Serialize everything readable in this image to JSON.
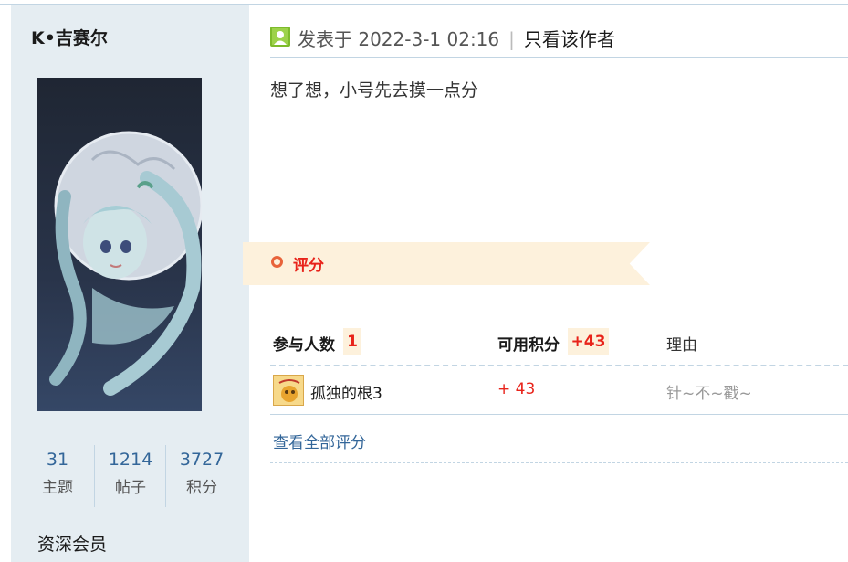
{
  "author": {
    "name": "K•吉赛尔",
    "stats": [
      {
        "value": "31",
        "label": "主题"
      },
      {
        "value": "1214",
        "label": "帖子"
      },
      {
        "value": "3727",
        "label": "积分"
      }
    ],
    "rank": "资深会员"
  },
  "post": {
    "posted_at_label": "发表于 2022-3-1 02:16",
    "separator": "|",
    "only_author_label": "只看该作者",
    "content": "想了想，小号先去摸一点分"
  },
  "rating": {
    "section_label": "评分",
    "participants_label": "参与人数",
    "participants_count": "1",
    "points_label": "可用积分",
    "points_total": "+43",
    "reason_label": "理由",
    "rows": [
      {
        "name": "孤独的根3",
        "score": "+ 43",
        "reason": "针~不~戳~"
      }
    ],
    "view_all_label": "查看全部评分"
  },
  "colors": {
    "sidebar_bg": "#e5edf2",
    "link": "#336699",
    "accent_red": "#e8231a",
    "ribbon_bg": "#fdf1dc",
    "online_icon": "#7dbb2b"
  },
  "icons": {
    "post_icon": "user-online-icon",
    "rating_icon": "circle-icon"
  }
}
